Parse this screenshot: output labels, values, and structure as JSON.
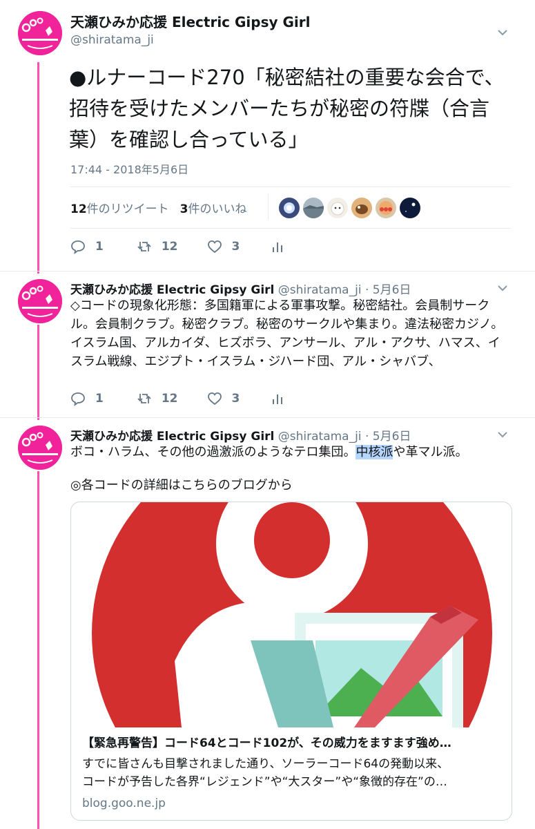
{
  "colors": {
    "accent": "#ff4fb8",
    "avatar_bg": "#f0239a",
    "muted": "#657786",
    "text": "#14171a",
    "highlight": "#b4d5fe"
  },
  "main_tweet": {
    "display_name": "天瀬ひみか応援 Electric Gipsy Girl",
    "handle": "@shiratama_ji",
    "text": "●ルナーコード270「秘密結社の重要な会合で、招待を受けたメンバーたちが秘密の符牒（合言葉）を確認し合っている」",
    "timestamp": "17:44 - 2018年5月6日",
    "retweet_count": "12",
    "retweet_label": "件のリツイート",
    "like_count": "3",
    "like_label": "件のいいね",
    "likers": [
      "moon-avatar",
      "lake-avatar",
      "dog-avatar",
      "bird-avatar",
      "anpanman-avatar",
      "night-sky-avatar"
    ],
    "actions": {
      "reply_count": "1",
      "retweet_count": "12",
      "like_count": "3"
    }
  },
  "reply1": {
    "display_name": "天瀬ひみか応援 Electric Gipsy Girl",
    "handle": "@shiratama_ji",
    "date": "5月6日",
    "text": "◇コードの現象化形態：多国籍軍による軍事攻撃。秘密結社。会員制サークル。会員制クラブ。秘密クラブ。秘密のサークルや集まり。違法秘密カジノ。イスラム国、アルカイダ、ヒズボラ、アンサール、アル・アクサ、ハマス、イスラム戦線、エジプト・イスラム・ジハード団、アル・シャバブ、",
    "actions": {
      "reply_count": "1",
      "retweet_count": "12",
      "like_count": "3"
    }
  },
  "reply2": {
    "display_name": "天瀬ひみか応援 Electric Gipsy Girl",
    "handle": "@shiratama_ji",
    "date": "5月6日",
    "text_before": "ボコ・ハラム、その他の過激派のようなテロ集団。",
    "text_highlight": "中核派",
    "text_after": "や革マル派。",
    "text_line2": "◎各コードの詳細はこちらのブログから",
    "card": {
      "title": "【緊急再警告】コード64とコード102が、その威力をますます強め…",
      "desc_line1": "すでに皆さんも目撃されました通り、ソーラーコード64の発動以来、",
      "desc_line2": "コードが予告した各界“レジェンド”や“大スター”や“象徴的存在”の…",
      "domain": "blog.goo.ne.jp",
      "image": "goo-blog-logo-with-picture-edit-icon"
    }
  }
}
